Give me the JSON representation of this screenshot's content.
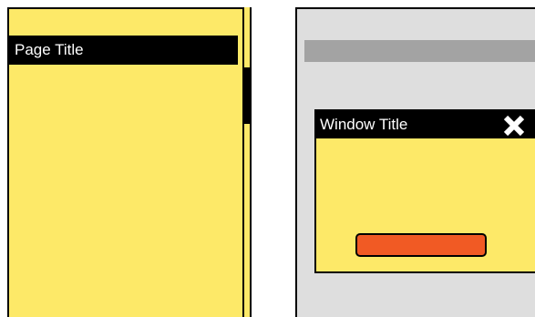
{
  "page": {
    "title": "Page Title"
  },
  "window": {
    "title": "Window Title",
    "close_icon": "close-icon"
  },
  "colors": {
    "panel_yellow": "#fde968",
    "title_black": "#000000",
    "screen_gray": "#dedede",
    "strip_gray": "#a3a3a3",
    "button_orange": "#f15a24"
  }
}
